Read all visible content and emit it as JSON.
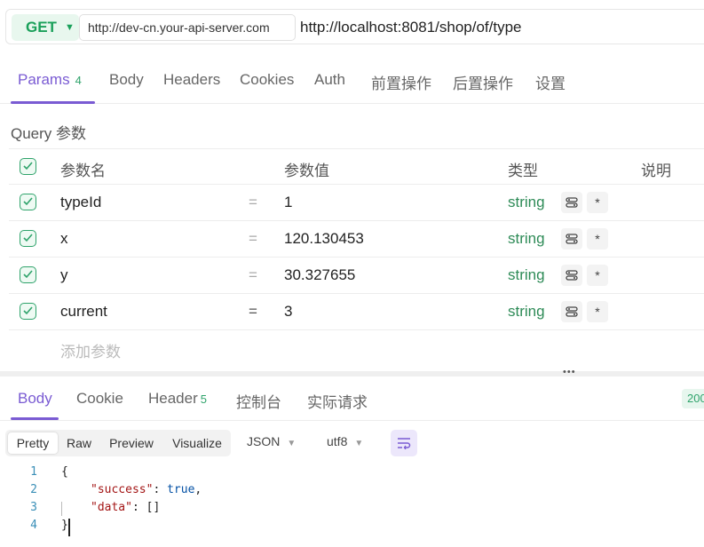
{
  "request": {
    "method": "GET",
    "environment": "http://dev-cn.your-api-server.com",
    "path": "http://localhost:8081/shop/of/type"
  },
  "request_tabs": [
    {
      "label": "Params",
      "badge": "4"
    },
    {
      "label": "Body"
    },
    {
      "label": "Headers"
    },
    {
      "label": "Cookies"
    },
    {
      "label": "Auth"
    },
    {
      "label": "前置操作"
    },
    {
      "label": "后置操作"
    },
    {
      "label": "设置"
    }
  ],
  "query_section_title": "Query 参数",
  "params_header": {
    "name": "参数名",
    "value": "参数值",
    "type": "类型",
    "desc": "说明"
  },
  "params": [
    {
      "name": "typeId",
      "eq": "=",
      "value": "1",
      "type": "string",
      "required": "*"
    },
    {
      "name": "x",
      "eq": "=",
      "value": "120.130453",
      "type": "string",
      "required": "*"
    },
    {
      "name": "y",
      "eq": "=",
      "value": "30.327655",
      "type": "string",
      "required": "*"
    },
    {
      "name": "current",
      "eq": "=",
      "value": "3",
      "type": "string",
      "required": "*"
    }
  ],
  "add_param_placeholder": "添加参数",
  "splitter_grip": "•••",
  "response_tabs": [
    {
      "label": "Body"
    },
    {
      "label": "Cookie"
    },
    {
      "label": "Header",
      "badge": "5"
    },
    {
      "label": "控制台"
    },
    {
      "label": "实际请求"
    }
  ],
  "status_code": "200",
  "view_modes": [
    "Pretty",
    "Raw",
    "Preview",
    "Visualize"
  ],
  "format_select": "JSON",
  "encoding_select": "utf8",
  "code_lines": [
    {
      "no": "1",
      "text": "{"
    },
    {
      "no": "2",
      "key": "\"success\"",
      "sep": ": ",
      "val": "true",
      "tail": ","
    },
    {
      "no": "3",
      "key": "\"data\"",
      "sep": ": ",
      "tail": "[]"
    },
    {
      "no": "4",
      "text": "}"
    }
  ],
  "colors": {
    "accent": "#7a5bd3",
    "success": "#2fa36b",
    "type": "#2e8b57"
  }
}
